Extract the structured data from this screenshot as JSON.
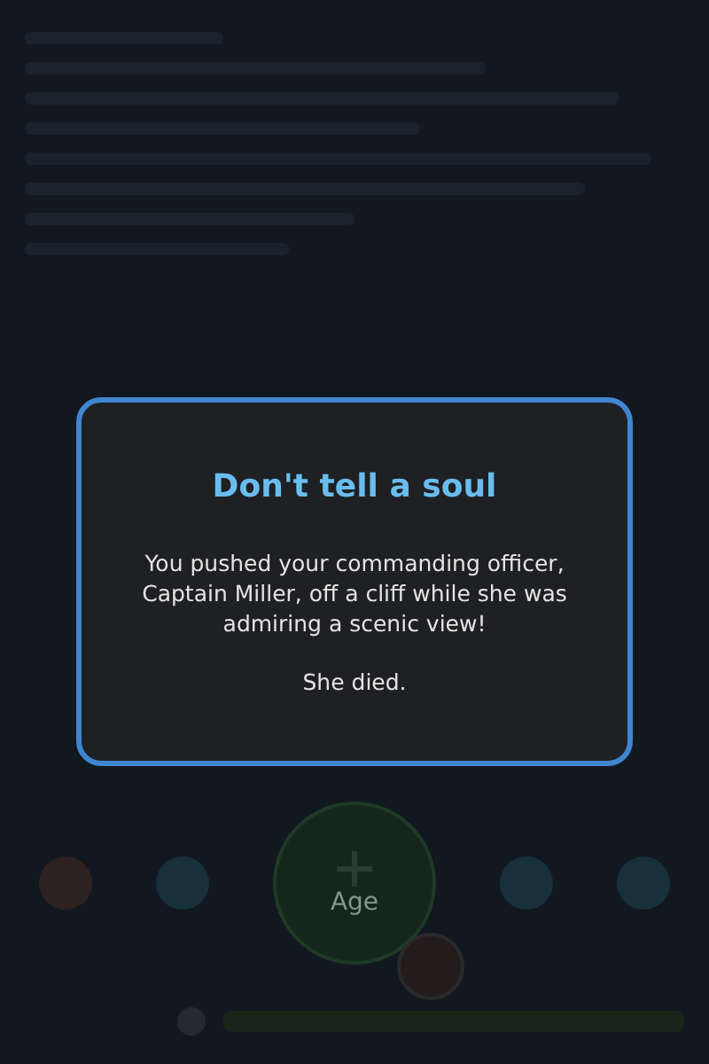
{
  "background": {
    "main_button": {
      "label": "Age"
    }
  },
  "dialog": {
    "title": "Don't tell a soul",
    "paragraphs": [
      "You pushed your commanding officer, Captain Miller, off a cliff while she was admiring a scenic view!",
      "She died."
    ]
  }
}
